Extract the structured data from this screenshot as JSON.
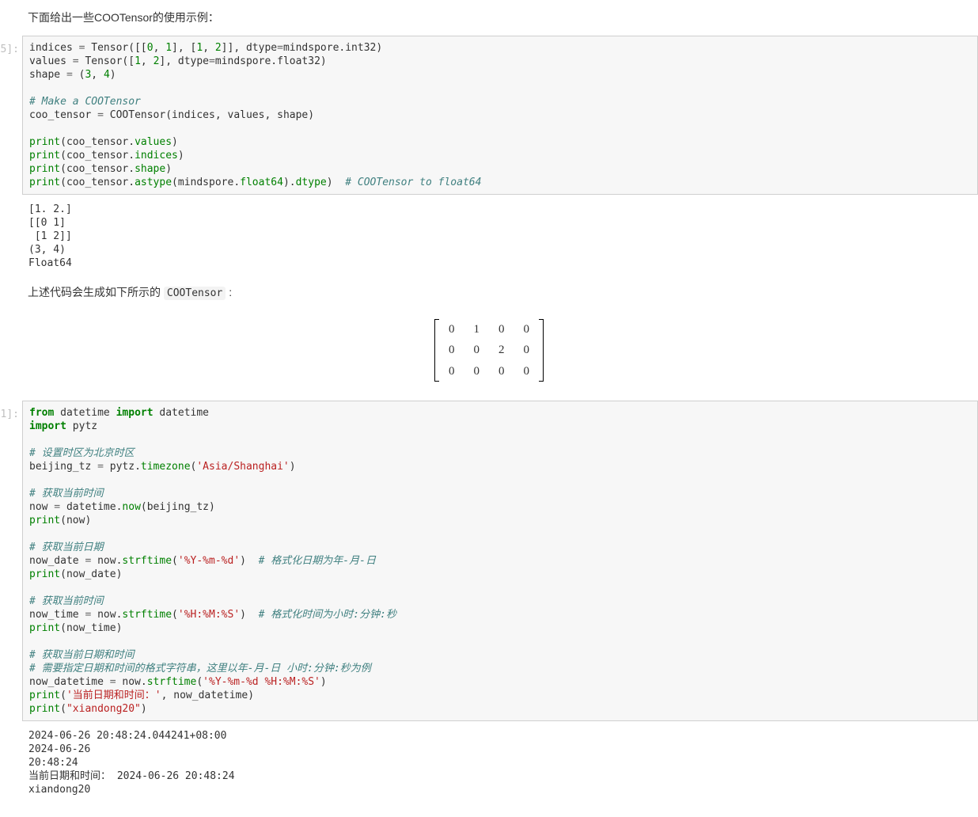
{
  "intro_text": "下面给出一些COOTensor的使用示例：",
  "cell5_prompt": "5]:",
  "cell5": {
    "t": {
      "indices": "indices",
      "values": "values",
      "shape": "shape",
      "eq": " = ",
      "Tensor": "Tensor",
      "lp": "(",
      "rp": ")",
      "lb": "[",
      "rb": "]",
      "comma_sp": ", ",
      "n0": "0",
      "n1": "1",
      "n2": "2",
      "n3": "3",
      "n4": "4",
      "dtype_kw": "dtype",
      "mindspore": "mindspore",
      "dot": ".",
      "int32": "int32",
      "float32": "float32",
      "c_make": "# Make a COOTensor",
      "coo_tensor": "coo_tensor",
      "COOTensor": "COOTensor",
      "print": "print",
      "values_attr": "values",
      "indices_attr": "indices",
      "shape_attr": "shape",
      "astype": "astype",
      "float64": "float64",
      "dtype_attr": "dtype",
      "c_tofloat64": "# COOTensor to float64"
    }
  },
  "output5": "[1. 2.]\n[[0 1]\n [1 2]]\n(3, 4)\nFloat64",
  "coo_desc_pre": "上述代码会生成如下所示的 ",
  "coo_desc_code": "COOTensor",
  "coo_desc_post": " :",
  "matrix": [
    [
      "0",
      "1",
      "0",
      "0"
    ],
    [
      "0",
      "0",
      "2",
      "0"
    ],
    [
      "0",
      "0",
      "0",
      "0"
    ]
  ],
  "cell1_prompt": "1]:",
  "cell1": {
    "t": {
      "from": "from",
      "datetime": "datetime",
      "import": "import",
      "datetime2": "datetime",
      "pytz": "pytz",
      "c_tz": "# 设置时区为北京时区",
      "beijing_tz": "beijing_tz",
      "eq": " = ",
      "dot": ".",
      "timezone": "timezone",
      "lp": "(",
      "rp": ")",
      "s_shanghai": "'Asia/Shanghai'",
      "c_now": "# 获取当前时间",
      "now": "now",
      "now_fn": "now",
      "print": "print",
      "c_date": "# 获取当前日期",
      "now_date": "now_date",
      "strftime": "strftime",
      "s_ymd": "'%Y-%m-%d'",
      "c_fmt_date": "# 格式化日期为年-月-日",
      "c_time": "# 获取当前时间",
      "now_time": "now_time",
      "s_hms": "'%H:%M:%S'",
      "c_fmt_time": "# 格式化时间为小时:分钟:秒",
      "c_dt1": "# 获取当前日期和时间",
      "c_dt2": "# 需要指定日期和时间的格式字符串，这里以年-月-日 小时:分钟:秒为例",
      "now_datetime": "now_datetime",
      "s_ymdhms": "'%Y-%m-%d %H:%M:%S'",
      "s_label": "'当前日期和时间：'",
      "comma_sp": ", ",
      "s_xd": "\"xiandong20\""
    }
  },
  "output1": "2024-06-26 20:48:24.044241+08:00\n2024-06-26\n20:48:24\n当前日期和时间： 2024-06-26 20:48:24\nxiandong20"
}
